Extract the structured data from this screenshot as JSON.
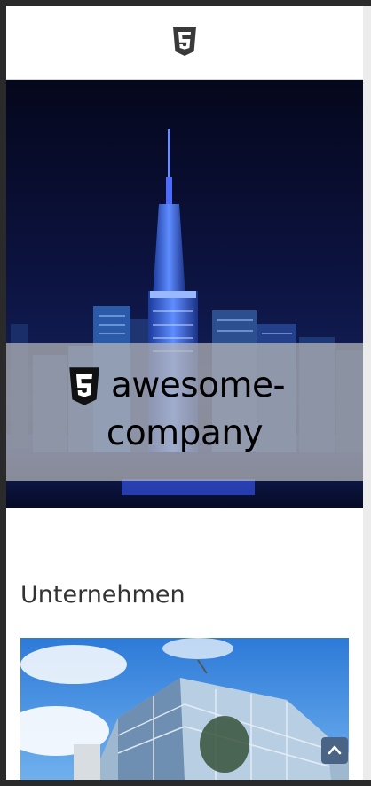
{
  "header": {
    "logo_icon": "html5-logo-icon"
  },
  "hero": {
    "brand_line1": "awesome-",
    "brand_line2": "company",
    "brand_icon": "html5-shield-icon"
  },
  "section": {
    "title": "Unternehmen"
  },
  "scroll_top": {
    "icon": "chevron-up-icon"
  },
  "colors": {
    "page_bg": "#ffffff",
    "frame": "#2a2a2a",
    "hero_sky": "#0a0f2e",
    "scroll_button": "#4a6486"
  }
}
